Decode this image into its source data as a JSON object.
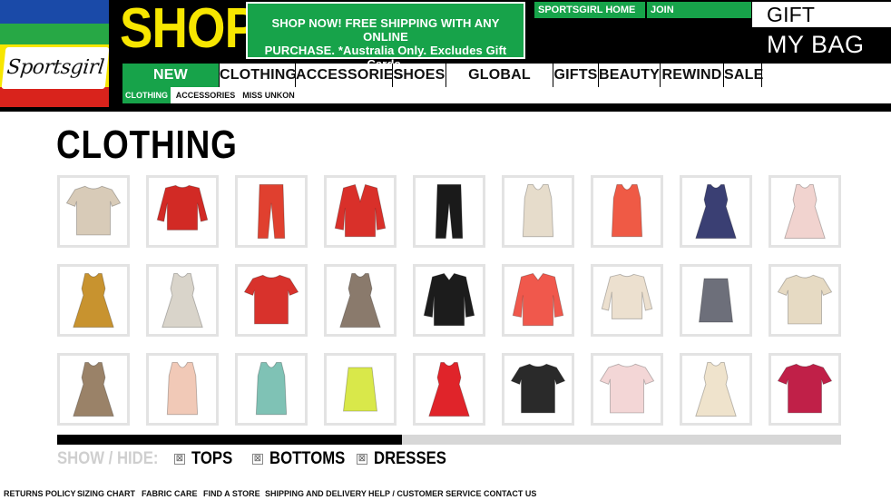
{
  "header": {
    "logo_text": "Sportsgirl",
    "shop_title": "SHOP",
    "promo_line1": "SHOP NOW! FREE SHIPPING WITH ANY ONLINE",
    "promo_line2": "PURCHASE. *Australia Only. Excludes Gift Cards.",
    "top_links": {
      "home": "SPORTSGIRL HOME",
      "join": "JOIN"
    },
    "gift_cards": "GIFT CARDS",
    "my_bag": "MY BAG",
    "colors": {
      "yellow": "#f7e600",
      "green": "#17a34a",
      "blue": "#1a4aa8",
      "red": "#d9231c"
    }
  },
  "main_nav": [
    "NEW ARRIVALS",
    "CLOTHING",
    "ACCESSORIES",
    "SHOES",
    "GLOBAL TRENDS",
    "GIFTS",
    "BEAUTY",
    "REWIND",
    "SALE"
  ],
  "sub_nav": [
    "CLOTHING",
    "ACCESSORIES",
    "MISS UNKON"
  ],
  "page_title": "CLOTHING",
  "products": [
    {
      "name": "sequin-top",
      "shape": "tee",
      "color": "#d8cbb8"
    },
    {
      "name": "red-knit-jumper",
      "shape": "sweater",
      "color": "#d22a25"
    },
    {
      "name": "red-pants",
      "shape": "pants",
      "color": "#e0402f"
    },
    {
      "name": "red-blazer",
      "shape": "blazer",
      "color": "#d9302a"
    },
    {
      "name": "black-pants",
      "shape": "pants",
      "color": "#1a1a1a"
    },
    {
      "name": "cream-stripe-tank",
      "shape": "tank",
      "color": "#e6dccb"
    },
    {
      "name": "coral-lace-tank",
      "shape": "tank",
      "color": "#ef5a45"
    },
    {
      "name": "stripe-dress",
      "shape": "dress",
      "color": "#3a3f73"
    },
    {
      "name": "floral-dress",
      "shape": "dress",
      "color": "#f1d3cf"
    },
    {
      "name": "print-dress",
      "shape": "dress",
      "color": "#c8932f"
    },
    {
      "name": "sequin-slip-dress",
      "shape": "dress",
      "color": "#d9d4ca"
    },
    {
      "name": "red-sheer-tee",
      "shape": "tee",
      "color": "#d8322c"
    },
    {
      "name": "floral-slip-dress",
      "shape": "dress",
      "color": "#8a7a6c"
    },
    {
      "name": "black-sheer-shirt",
      "shape": "shirt",
      "color": "#1c1c1c"
    },
    {
      "name": "coral-shirt",
      "shape": "shirt",
      "color": "#f0584c"
    },
    {
      "name": "fringe-knit-top",
      "shape": "sweater",
      "color": "#ece0cf"
    },
    {
      "name": "stripe-skirt",
      "shape": "skirt",
      "color": "#6d6f7a"
    },
    {
      "name": "crochet-top",
      "shape": "tee",
      "color": "#e6dac3"
    },
    {
      "name": "floral-tea-dress",
      "shape": "dress",
      "color": "#9a8268"
    },
    {
      "name": "rose-print-cami",
      "shape": "tank",
      "color": "#f1c9b7"
    },
    {
      "name": "mint-tank",
      "shape": "tank",
      "color": "#7fc2b5"
    },
    {
      "name": "lime-bandage-skirt",
      "shape": "skirt",
      "color": "#d9e84a"
    },
    {
      "name": "red-skater-dress",
      "shape": "dress",
      "color": "#e0242a"
    },
    {
      "name": "stripe-print-tee",
      "shape": "tee",
      "color": "#2a2a2a"
    },
    {
      "name": "floral-boxy-tee",
      "shape": "tee",
      "color": "#f3d6d6"
    },
    {
      "name": "cream-lace-dress",
      "shape": "dress",
      "color": "#efe3cc"
    },
    {
      "name": "magenta-tee",
      "shape": "tee",
      "color": "#c02048"
    }
  ],
  "scroll_progress": 0.44,
  "filters": {
    "label": "SHOW / HIDE:",
    "items": [
      {
        "label": "TOPS",
        "mark": "⊠"
      },
      {
        "label": "BOTTOMS",
        "mark": "⊠"
      },
      {
        "label": "DRESSES",
        "mark": "⊠"
      }
    ]
  },
  "footer_links": [
    "RETURNS POLICY",
    "SIZING CHART",
    "FABRIC CARE",
    "FIND A STORE",
    "SHIPPING AND DELIVERY",
    "HELP / CUSTOMER SERVICE",
    "CONTACT US"
  ]
}
